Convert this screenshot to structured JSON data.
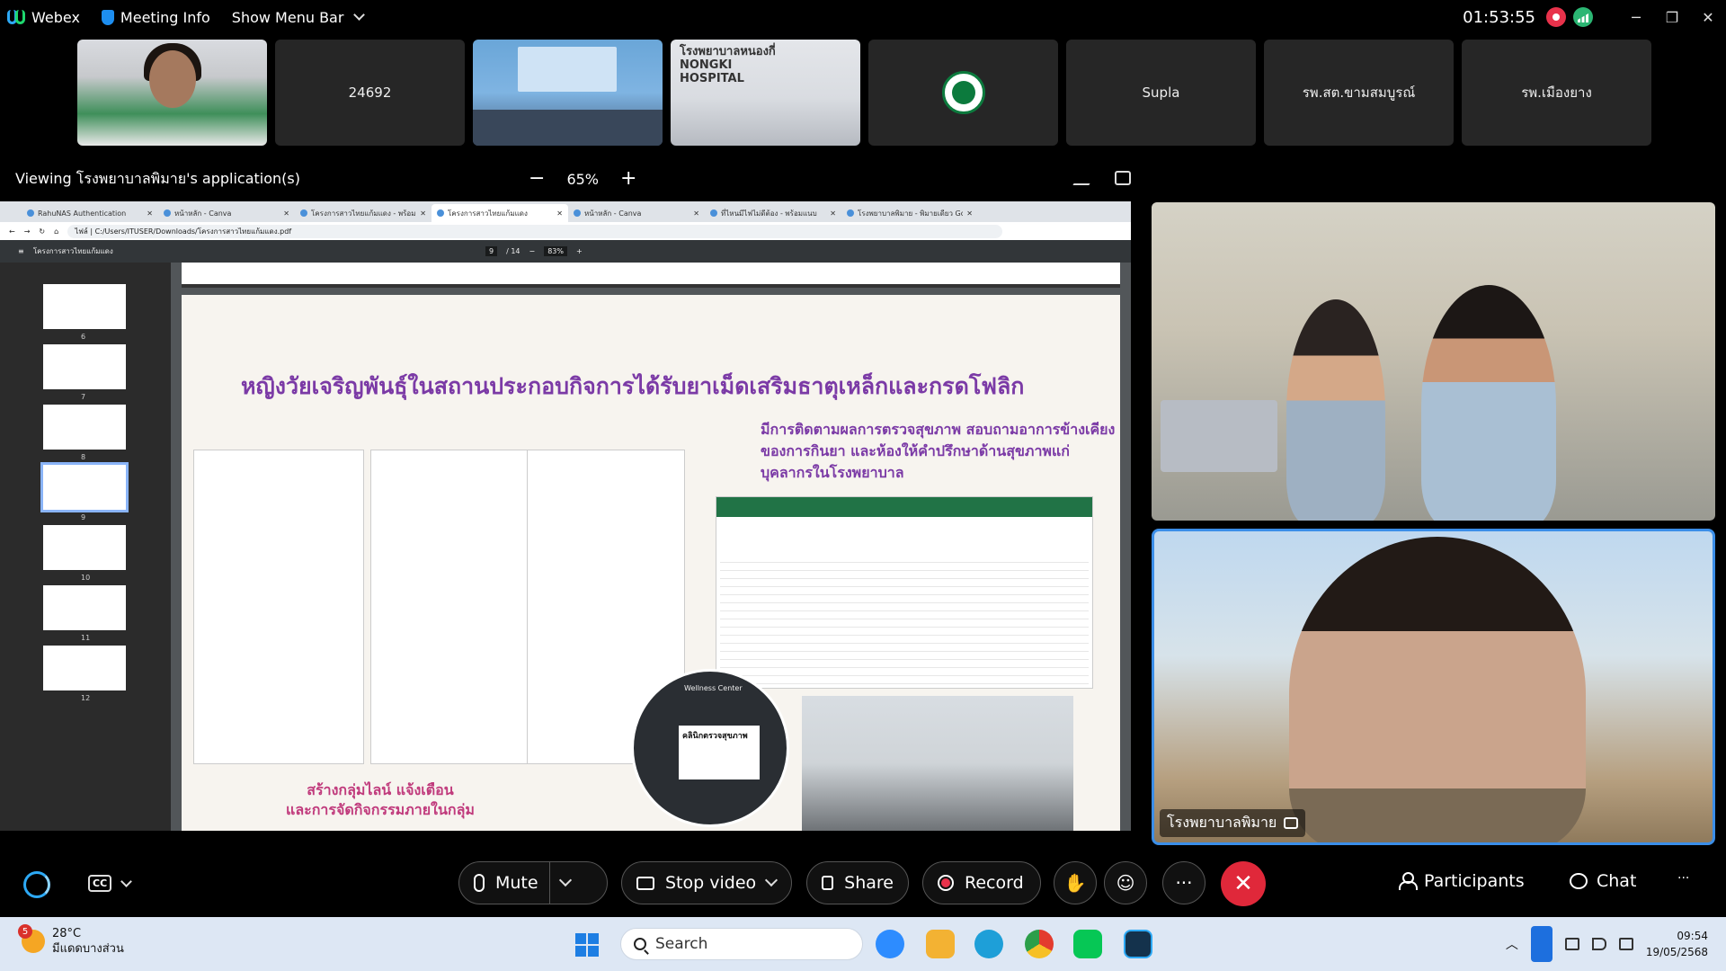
{
  "titlebar": {
    "app_name": "Webex",
    "meeting_info": "Meeting Info",
    "menu_bar": "Show Menu Bar",
    "time": "01:53:55",
    "minimize": "─",
    "restore": "❐",
    "close": "✕"
  },
  "participants": [
    {
      "label": ""
    },
    {
      "label": "24692"
    },
    {
      "label": ""
    },
    {
      "label": "",
      "sign": "โรงพยาบาลหนองกี่ NONGKI HOSPITAL"
    },
    {
      "label": ""
    },
    {
      "label": "Supla"
    },
    {
      "label": "รพ.สต.ขามสมบูรณ์"
    },
    {
      "label": "รพ.เมืองยาง"
    }
  ],
  "viewbar": {
    "viewing": "Viewing โรงพยาบาลพิมาย's application(s)",
    "zoom_minus": "−",
    "zoom": "65%",
    "zoom_plus": "+"
  },
  "shared": {
    "tabs": [
      {
        "label": "RahuNAS Authentication"
      },
      {
        "label": "หน้าหลัก - Canva"
      },
      {
        "label": "โครงการสาวไทยแก้มแดง - พร้อมแนบ"
      },
      {
        "label": "โครงการสาวไทยแก้มแดง"
      },
      {
        "label": "หน้าหลัก - Canva"
      },
      {
        "label": "ที่ไหนมีไฟไม่ดีต้อง - พร้อมแนบ"
      },
      {
        "label": "โรงพยาบาลพิมาย - พิมายเดียว Goo"
      }
    ],
    "address_prefix": "ไฟล์",
    "url": "C:/Users/ITUSER/Downloads/โครงการสาวไทยแก้มแดง.pdf",
    "pdf_title": "โครงการสาวไทยแก้มแดง",
    "page": "9",
    "page_total": "/ 14",
    "pdf_zoom": "83%",
    "thumb_labels": [
      "6",
      "7",
      "8",
      "9",
      "10",
      "11",
      "12"
    ],
    "slide_title": "หญิงวัยเจริญพันธุ์ในสถานประกอบกิจการได้รับยาเม็ดเสริมธาตุเหล็กและกรดโฟลิก",
    "slide_sub": "มีการติดตามผลการตรวจสุขภาพ สอบถามอาการข้างเคียงของการกินยา และห้องให้คำปรึกษาด้านสุขภาพแก่บุคลากรในโรงพยาบาล",
    "slide_bottom_1": "สร้างกลุ่มไลน์ แจ้งเตือน",
    "slide_bottom_2": "และการจัดกิจกรรมภายในกลุ่ม",
    "wellness_sign": "Wellness Center",
    "clinic_sign": "คลินิกตรวจสุขภาพ"
  },
  "videos": {
    "main_name": "โรงพยาบาลพิมาย"
  },
  "controls": {
    "mute": "Mute",
    "stop_video": "Stop video",
    "share": "Share",
    "record": "Record",
    "more": "···",
    "end": "✕",
    "participants": "Participants",
    "chat": "Chat",
    "overflow": "···",
    "cc": "CC"
  },
  "taskbar": {
    "weather_badge": "5",
    "temp": "28°C",
    "weather_desc": "มีแดดบางส่วน",
    "search": "Search",
    "time": "09:54",
    "date": "19/05/2568"
  },
  "colors": {
    "accent": "#3b8ee8",
    "end_call": "#e0283a",
    "record_red": "#e8324b",
    "slide_purple": "#7b3aa6"
  }
}
